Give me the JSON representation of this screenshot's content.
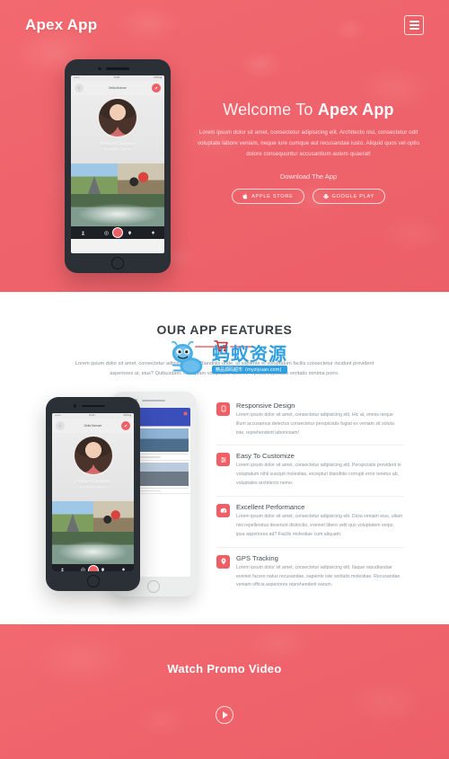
{
  "site": {
    "brand": "Apex App"
  },
  "navbar": {
    "menu_icon": "hamburger-menu-icon"
  },
  "hero": {
    "title_light": "Welcome To ",
    "title_bold": "Apex App",
    "paragraph": "Lorem ipsum dolor sit amet, consectetur adipisicing elit. Architecto nisi, consectetur odit voluptate labore veniam, neque iure cumque aut recusandae iusto. Aliquid quos vel optio dolore consequuntur accusantium autem quaerat!",
    "download_label": "Download The App",
    "buttons": [
      {
        "label": "APPLE STORE",
        "icon": "apple-icon"
      },
      {
        "label": "GOOGLE PLAY",
        "icon": "android-icon"
      }
    ],
    "phone": {
      "status_left": "••••• ▾",
      "status_center": "10:00",
      "status_right": "100% ▮",
      "app_title": "Delta Mcinure",
      "profile_name": "Product Designer",
      "profile_sub": "San Francisco, California"
    }
  },
  "features": {
    "title": "OUR APP FEATURES",
    "intro": "Lorem ipsum dolor sit amet, consectetur adipisicing elit. Blanditiis unde, ut sapiente et voluptatum facilis consectetur incidunt provident asperiores at, eius? Quibusdam, numquam voluptates dolores repellat explicabo veritatis minima porro.",
    "items": [
      {
        "icon": "tablet-icon",
        "title": "Responsive Design",
        "text": "Lorem ipsum dolor sit amet, consectetur adipisicing elit. Hic at, omnis neque illum accusamus delectus consectetur perspiciatis fugiat ex veniam sit soluta iste, reprehenderit laboriosam!"
      },
      {
        "icon": "sliders-icon",
        "title": "Easy To Customize",
        "text": "Lorem ipsum dolor sit amet, consectetur adipisicing elit. Perspiciatis provident in voluptatum nihil suscipit molestias, excepturi blanditiis corrupti error tenetur ab, voluptates architecto nemo."
      },
      {
        "icon": "speedometer-icon",
        "title": "Excellent Performance",
        "text": "Lorem ipsum dolor sit amet, consectetur adipisicing elit. Dicta veniam eius, ullam nisi repellendus deserunt distinctio, eveniet libero velit quo voluptatem sequi, ipsa asperiores ad? Facilis molestiae cum aliquam."
      },
      {
        "icon": "map-pin-icon",
        "title": "GPS Tracking",
        "text": "Lorem ipsum dolor sit amet, consectetur adipisicing elit. Itaque repudiandae eveniet facere natus recusandae, sapiente iste veritatis molestiae. Recusandae veniam officia asperiores reprehenderit earum."
      }
    ]
  },
  "promo": {
    "title": "Watch Promo Video",
    "play_icon": "play-icon"
  },
  "watermark": {
    "text_cn": "蚂蚁资源",
    "bar_cn": "精品源码超市",
    "bar_url": "(myziyuan.com)"
  },
  "colors": {
    "brand_red": "#ef5f66",
    "hero_bg": "#f2696f",
    "watermark_blue": "#2f9fe0",
    "heading": "#3a3f44",
    "body_text": "#8a9097"
  }
}
